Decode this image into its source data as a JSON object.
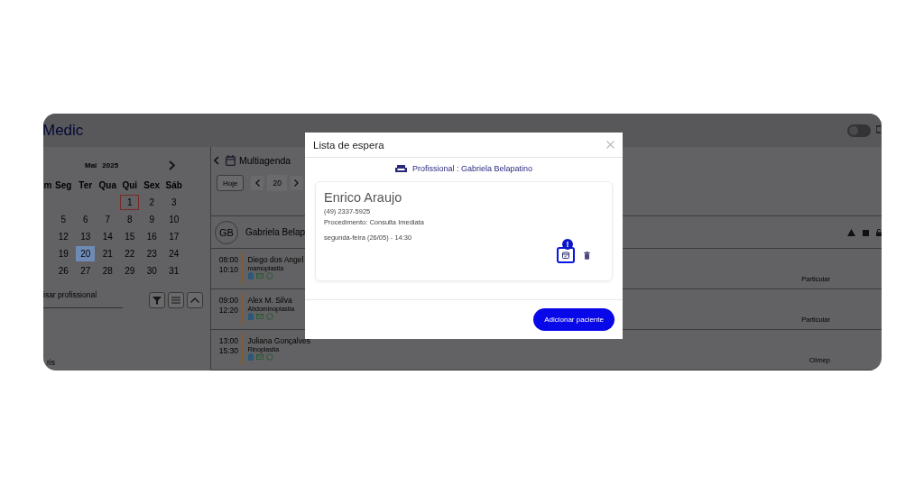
{
  "app": {
    "logo": "Medic",
    "toggle": {
      "on": false
    }
  },
  "calendar": {
    "month": "Mai",
    "year": "2025",
    "weekdays": [
      "m",
      "Seg",
      "Ter",
      "Qua",
      "Qui",
      "Sex",
      "Sáb"
    ],
    "weeks": [
      [
        {
          "d": "1",
          "selected": false,
          "today": true
        },
        {
          "d": "2",
          "selected": false,
          "today": false
        },
        {
          "d": "3",
          "selected": false,
          "today": false
        }
      ],
      [
        {
          "d": "5",
          "selected": false,
          "today": false
        },
        {
          "d": "6",
          "selected": false,
          "today": false
        },
        {
          "d": "7",
          "selected": false,
          "today": false
        },
        {
          "d": "8",
          "selected": false,
          "today": false
        },
        {
          "d": "9",
          "selected": false,
          "today": false
        },
        {
          "d": "10",
          "selected": false,
          "today": false
        }
      ],
      [
        {
          "d": "12",
          "selected": false,
          "today": false
        },
        {
          "d": "13",
          "selected": false,
          "today": false
        },
        {
          "d": "14",
          "selected": false,
          "today": false
        },
        {
          "d": "15",
          "selected": false,
          "today": false
        },
        {
          "d": "16",
          "selected": false,
          "today": false
        },
        {
          "d": "17",
          "selected": false,
          "today": false
        }
      ],
      [
        {
          "d": "19",
          "selected": false,
          "today": false
        },
        {
          "d": "20",
          "selected": true,
          "today": false
        },
        {
          "d": "21",
          "selected": false,
          "today": false
        },
        {
          "d": "22",
          "selected": false,
          "today": false
        },
        {
          "d": "23",
          "selected": false,
          "today": false
        },
        {
          "d": "24",
          "selected": false,
          "today": false
        }
      ],
      [
        {
          "d": "26",
          "selected": false,
          "today": false
        },
        {
          "d": "27",
          "selected": false,
          "today": false
        },
        {
          "d": "28",
          "selected": false,
          "today": false
        },
        {
          "d": "29",
          "selected": false,
          "today": false
        },
        {
          "d": "30",
          "selected": false,
          "today": false
        },
        {
          "d": "31",
          "selected": false,
          "today": false
        }
      ]
    ]
  },
  "professional_search": {
    "placeholder": "isar profissional"
  },
  "sidebar_footer": "ris",
  "agenda": {
    "title": "Multiagenda",
    "today_button": "Hoje",
    "date": "20",
    "professional": {
      "initials": "GB",
      "name": "Gabriela Belap"
    },
    "appointments": [
      {
        "start": "08:00",
        "end": "10:10",
        "patient": "Diego dos Angel",
        "procedure": "mamoplastia",
        "plan": "Particular"
      },
      {
        "start": "09:00",
        "end": "12:20",
        "patient": "Alex M. Silva",
        "procedure": "Abdominoplastia",
        "plan": "Particular"
      },
      {
        "start": "13:00",
        "end": "15:30",
        "patient": "Juliana Gonçalves",
        "procedure": "Rinoplastia",
        "plan": "Climep"
      }
    ]
  },
  "modal": {
    "title": "Lista de espera",
    "professional_label": "Profissional : Gabriela Belapatino",
    "entries": [
      {
        "name": "Enrico Araujo",
        "phone": "(49) 2337-5925",
        "procedure": "Procedimento: Consulta Imediata",
        "schedule": "segunda-feira (26/05) - 14:30",
        "alert": "!"
      }
    ],
    "add_button": "Adicionar paciente"
  }
}
